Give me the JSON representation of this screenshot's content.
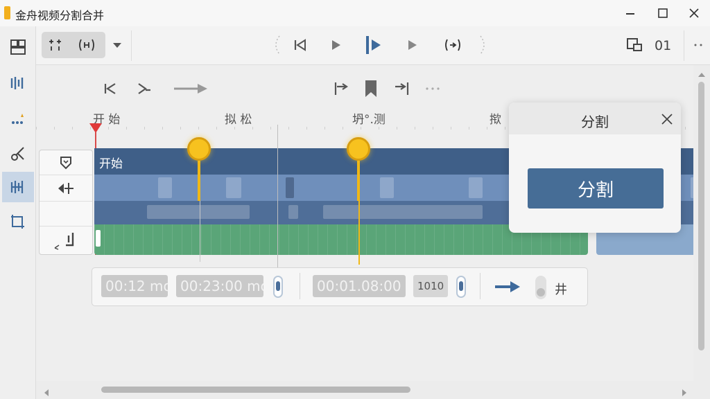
{
  "window": {
    "title": "金舟视频分割合并",
    "controls": [
      "minimize-icon",
      "maximize-icon",
      "close-icon"
    ]
  },
  "sidebar": {
    "items": [
      {
        "icon": "layout-icon",
        "active": false
      },
      {
        "icon": "split-tool-icon",
        "active": false
      },
      {
        "icon": "sparkle-icon",
        "active": false
      },
      {
        "icon": "scissors-icon",
        "active": false
      },
      {
        "icon": "merge-tool-icon",
        "active": true
      },
      {
        "icon": "crop-icon",
        "active": false
      }
    ]
  },
  "toolbar": {
    "left_icons": [
      "grid-dots-icon",
      "bracket-icon",
      "dropdown-icon"
    ],
    "center_icons": [
      "dotted-left-icon",
      "prev-frame-icon",
      "play-icon",
      "play-active-icon",
      "next-icon",
      "bracket-center-icon",
      "dotted-right-icon"
    ],
    "right_label": "01",
    "right_icons": [
      "window-icon",
      "more-icon"
    ]
  },
  "controls": {
    "icons": [
      "rewind-icon",
      "skip-icon",
      "arrow-right-icon",
      "mark-in-icon",
      "bookmark-icon",
      "mark-out-icon",
      "ellipsis-icon"
    ]
  },
  "ruler": {
    "labels": [
      "开 始",
      "拟 松",
      "坍°.测",
      "揿"
    ]
  },
  "timeline": {
    "clip_label": "开始",
    "split_markers": 2
  },
  "time_panel": {
    "start_time": "00:12 mo",
    "end_time": "00:23:00 mo",
    "duration": "00:01.08:00",
    "frames": "1010",
    "end_glyph": "井"
  },
  "dialog": {
    "title": "分割",
    "button": "分割"
  },
  "colors": {
    "accent": "#466d96",
    "marker": "#f7c21f",
    "video_track": "#3f5f88",
    "audio_track": "#5aa578"
  }
}
